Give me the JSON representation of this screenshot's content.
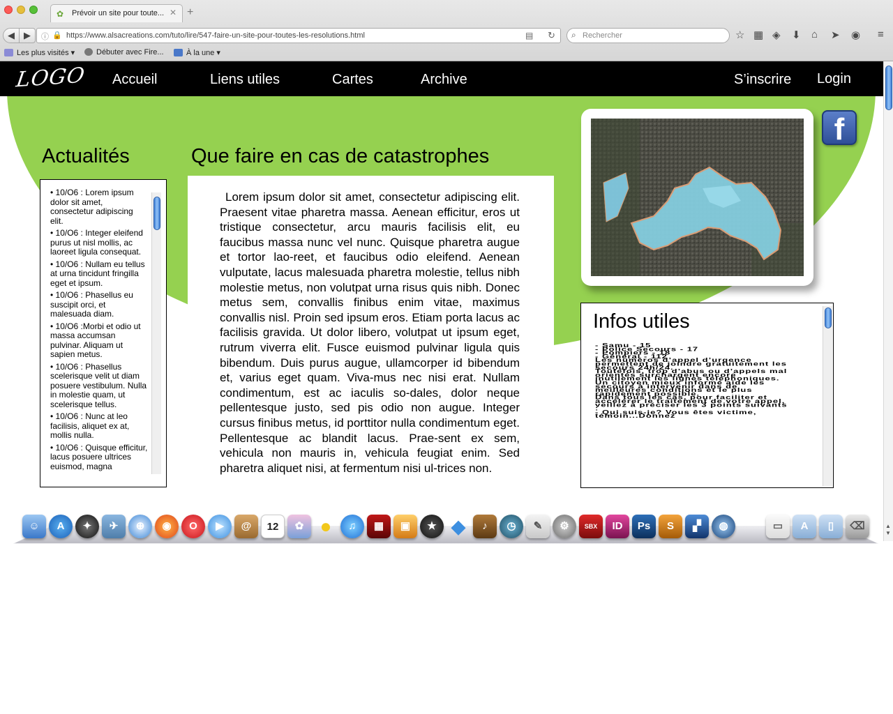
{
  "browser": {
    "tab_title": "Prévoir un site pour toute...",
    "url": "https://www.alsacreations.com/tuto/lire/547-faire-un-site-pour-toutes-les-resolutions.html",
    "search_placeholder": "Rechercher",
    "bookmarks": [
      {
        "label": "Les plus visités ▾",
        "icon": "folder-icon"
      },
      {
        "label": "Débuter avec Fire...",
        "icon": "firefox-gear-icon"
      },
      {
        "label": "À la une ▾",
        "icon": "rss-icon"
      }
    ]
  },
  "site": {
    "logo": "LOGO",
    "nav": [
      "Accueil",
      "Liens utiles",
      "Cartes",
      "Archive"
    ],
    "signup": "S’inscrire",
    "login": "Login"
  },
  "actualites": {
    "title": "Actualités",
    "items": [
      "• 10/O6 : Lorem ipsum dolor sit amet, consectetur adipiscing elit.",
      "• 10/O6 : Integer eleifend purus ut nisl mollis, ac laoreet ligula consequat.",
      "• 10/O6 : Nullam eu tellus at urna tincidunt fringilla eget et ipsum.",
      "• 10/O6 : Phasellus eu suscipit orci, et malesuada diam.",
      "• 10/O6 :Morbi et odio ut massa accumsan pulvinar. Aliquam ut sapien metus.",
      "• 10/O6 : Phasellus scelerisque velit ut diam posuere vestibulum. Nulla in molestie quam, ut scelerisque tellus.",
      "• 10/O6 : Nunc at leo facilisis, aliquet ex at, mollis nulla.",
      "• 10/O6 : Quisque efficitur, lacus posuere ultrices euismod, magna"
    ]
  },
  "article": {
    "title": "Que faire en cas de catastrophes",
    "body": "Lorem ipsum dolor sit amet, consectetur adipiscing elit. Praesent vitae pharetra massa. Aenean efficitur, eros ut tristique consectetur, arcu mauris facilisis elit, eu faucibus massa nunc vel nunc. Quisque pharetra augue et tortor lao-reet, et faucibus odio eleifend. Aenean vulputate, lacus malesuada pharetra molestie, tellus nibh molestie metus, non volutpat urna risus quis nibh. Donec metus sem, convallis finibus enim vitae, maximus convallis nisl. Proin sed ipsum eros. Etiam porta lacus ac facilisis gravida. Ut dolor libero, volutpat ut ipsum eget, rutrum viverra elit. Fusce euismod pulvinar ligula quis bibendum. Duis purus augue, ullamcorper id bibendum et, varius eget quam. Viva-mus nec nisi erat. Nullam condimentum, est ac iaculis so-dales, dolor neque pellentesque justo, sed pis odio non augue. Integer cursus finibus metus, id porttitor nulla condimentum eget. Pellentesque ac blandit lacus. Prae-sent ex sem, vehicula non mauris in, vehicula feugiat enim. Sed pharetra aliquet nisi, at fermentum nisi ul-trices non."
  },
  "infos": {
    "title": "Infos utiles",
    "lines": [
      "- Samu - 15",
      "- Police Secours - 17",
      "- Pompiers - 18",
      "- Général - 112",
      "Les numéros d’appel d’urgence permettent de joindre gratuitement les secours 24h/24.",
      "Toutefois, trop d’abus ou d’appels mal orientés surchargent encore inutilement les lignes téléphoniques.",
      "Un citoyen mieux informé aide les secours à intervenir dans de meilleures conditions et le plus rapidement possible.",
      "Dans tous les cas, pour faciliter et accélérer le traitement de votre appel, veillez à préciser les 3 points suivants :",
      "- Qui suis-je? Vous êtes victime, témoin...Donnez"
    ]
  },
  "facebook_letter": "f",
  "dock": {
    "calendar_day": "12",
    "indesign": "ID",
    "photoshop": "Ps",
    "sbx": "SBX"
  }
}
